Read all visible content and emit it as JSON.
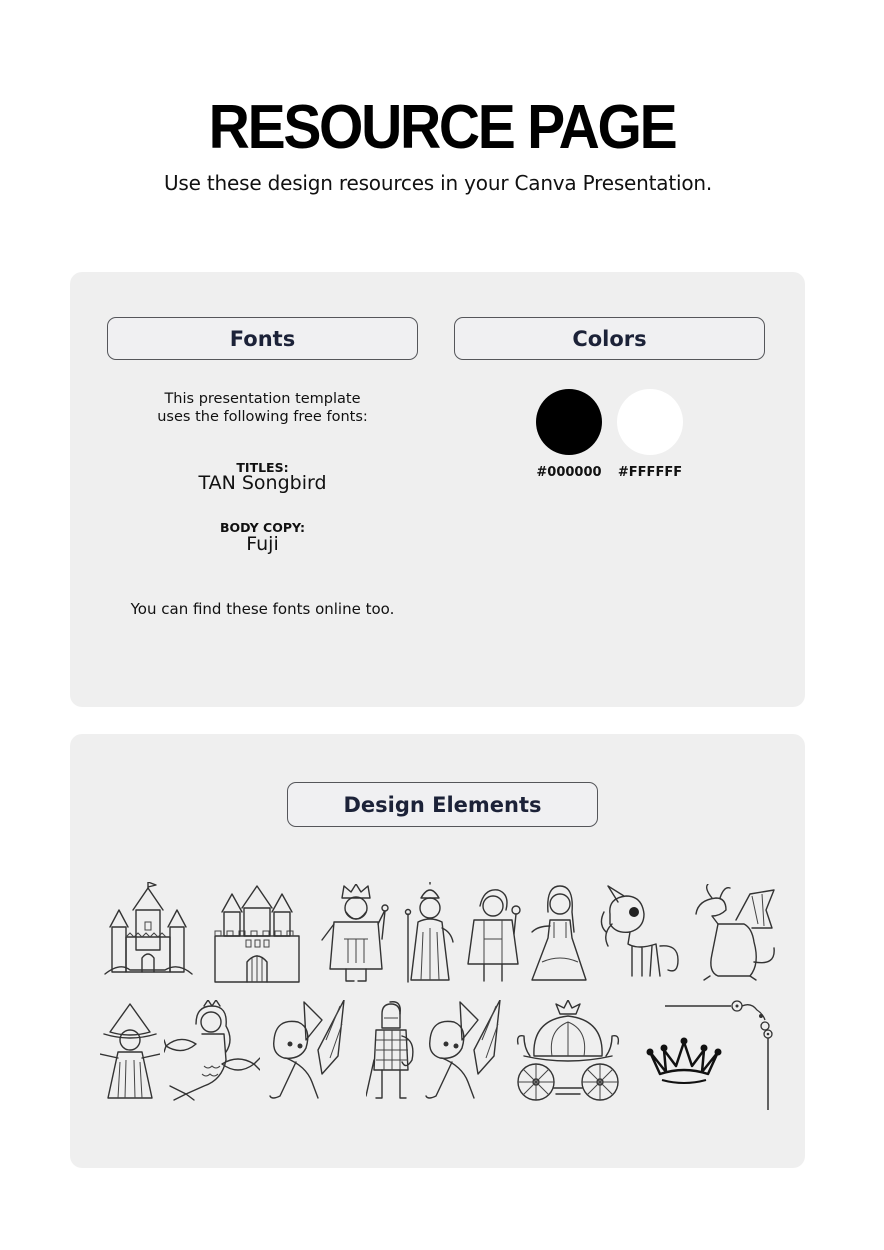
{
  "header": {
    "title": "RESOURCE PAGE",
    "subtitle": "Use these design resources in your Canva Presentation."
  },
  "fonts_section": {
    "heading": "Fonts",
    "intro_line1": "This presentation template",
    "intro_line2": "uses the following free fonts:",
    "titles_label": "TITLES:",
    "titles_font": "TAN Songbird",
    "body_label": "BODY COPY:",
    "body_font": "Fuji",
    "note": "You can find these fonts online too."
  },
  "colors_section": {
    "heading": "Colors",
    "swatches": [
      {
        "hex": "#000000",
        "label": "#000000"
      },
      {
        "hex": "#FFFFFF",
        "label": "#FFFFFF"
      }
    ]
  },
  "design_elements": {
    "heading": "Design Elements",
    "row1": [
      "castle-1",
      "castle-2",
      "king",
      "queen",
      "prince",
      "princess",
      "unicorn",
      "dragon"
    ],
    "row2": [
      "witch-girl",
      "mermaid",
      "fairy-1",
      "knight",
      "fairy-2",
      "carriage",
      "crown",
      "ornamental-corner"
    ]
  }
}
